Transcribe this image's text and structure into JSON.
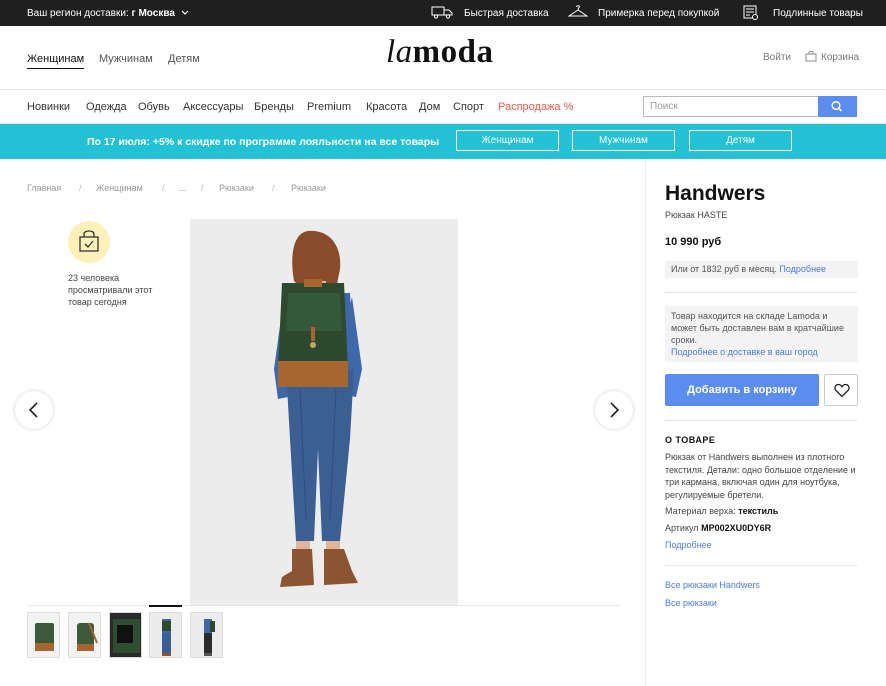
{
  "topbar": {
    "region_label": "Ваш регион доставки:",
    "region_value": "г Москва",
    "features": [
      "Быстрая доставка",
      "Примерка перед покупкой",
      "Подлинные товары"
    ]
  },
  "header": {
    "genders": [
      "Женщинам",
      "Мужчинам",
      "Детям"
    ],
    "logo_italic": "la",
    "logo_bold": "moda",
    "login": "Войти",
    "cart": "Корзина"
  },
  "nav": {
    "items": [
      "Новинки",
      "Одежда",
      "Обувь",
      "Аксессуары",
      "Бренды",
      "Premium",
      "Красота",
      "Дом",
      "Спорт"
    ],
    "sale": "Распродажа %",
    "search_placeholder": "Поиск"
  },
  "promo": {
    "text": "По 17 июля: +5% к скидке по программе лояльности на все товары",
    "buttons": [
      "Женщинам",
      "Мужчинам",
      "Детям"
    ]
  },
  "breadcrumb": [
    "Главная",
    "Женщинам",
    "...",
    "Рюкзаки",
    "Рюкзаки"
  ],
  "viewed": {
    "text": "23 человека просматривали этот товар сегодня"
  },
  "product": {
    "brand": "Handwers",
    "model": "Рюкзак HASTE",
    "price": "10 990 руб",
    "credit_text": "Или от 1832 руб в месяц.",
    "credit_link": "Подробнее",
    "stock_text": "Товар находится на складе Lamoda и может быть доставлен вам в кратчайшие сроки.",
    "stock_link": "Подробнее о доставке в ваш город",
    "add_to_cart": "Добавить в корзину",
    "about_heading": "О ТОВАРЕ",
    "about_text": "Рюкзак от Handwers выполнен из плотного текстиля. Детали: одно большое отделение и три кармана, включая один для ноутбука, регулируемые бретели.",
    "material_label": "Материал верха:",
    "material_value": "текстиль",
    "article_label": "Артикул",
    "article_value": "MP002XU0DY6R",
    "more_link": "Подробнее",
    "link_all_brand": "Все рюкзаки Handwers",
    "link_all": "Все рюкзаки"
  },
  "thumbnails": {
    "count": 5,
    "active_index": 3
  },
  "colors": {
    "accent": "#5b8def",
    "promo": "#24c1d4",
    "sale": "#e85a4f",
    "topbar": "#1f1f1f"
  }
}
